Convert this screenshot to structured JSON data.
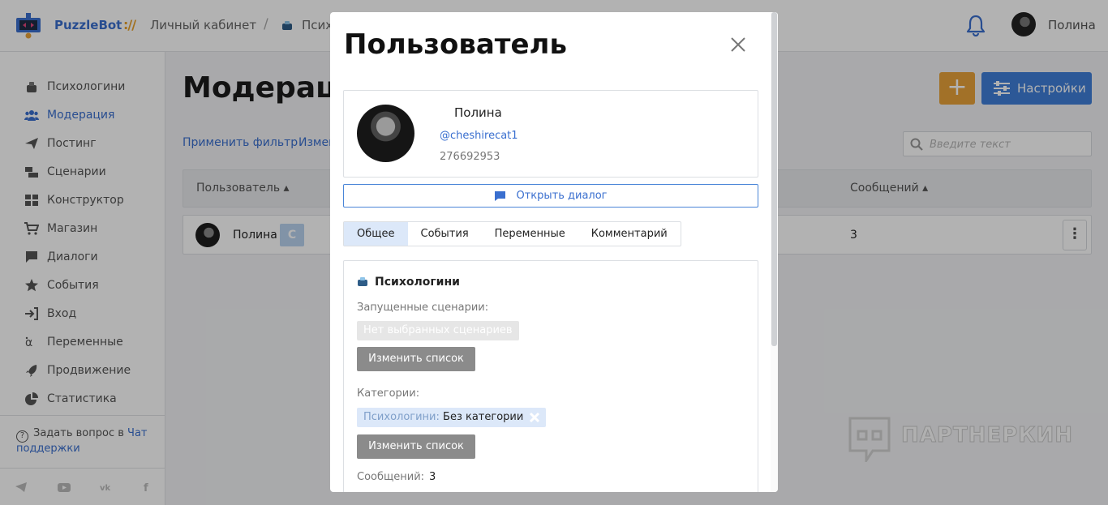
{
  "header": {
    "brand": "PuzzleBot",
    "separator": "://",
    "breadcrumb_root": "Личный кабинет",
    "breadcrumb_sep": "/",
    "breadcrumb_current": "Псих",
    "user_name": "Полина"
  },
  "sidebar": {
    "items": [
      {
        "label": "Психологини",
        "icon": "bot-icon"
      },
      {
        "label": "Модерация",
        "icon": "users-icon",
        "active": true
      },
      {
        "label": "Постинг",
        "icon": "send-icon"
      },
      {
        "label": "Сценарии",
        "icon": "scenarios-icon"
      },
      {
        "label": "Конструктор",
        "icon": "grid-icon"
      },
      {
        "label": "Магазин",
        "icon": "cart-icon"
      },
      {
        "label": "Диалоги",
        "icon": "chat-icon"
      },
      {
        "label": "События",
        "icon": "star-icon"
      },
      {
        "label": "Вход",
        "icon": "login-icon"
      },
      {
        "label": "Переменные",
        "icon": "alpha-icon"
      },
      {
        "label": "Продвижение",
        "icon": "rocket-icon"
      },
      {
        "label": "Статистика",
        "icon": "pie-icon"
      }
    ],
    "help_text": "Задать вопрос в",
    "help_link": "Чат поддержки",
    "social": [
      "telegram-icon",
      "youtube-icon",
      "vk-icon",
      "facebook-icon"
    ]
  },
  "main": {
    "title": "Модерац",
    "apply_filter": "Применить фильтр",
    "change_filter": "Измен",
    "add_label": "+",
    "settings_label": "Настройки",
    "search_placeholder": "Введите текст",
    "columns": {
      "user": "Пользователь ▴",
      "messages": "Сообщений ▴"
    },
    "rows": [
      {
        "name": "Полина",
        "badge": "С",
        "messages": "3"
      }
    ],
    "row_menu": "⋮"
  },
  "watermark": "ПАРТНЕРКИН",
  "modal": {
    "title": "Пользователь",
    "name": "Полина",
    "username": "@cheshirecat1",
    "user_id": "276692953",
    "open_dialog": "Открыть диалог",
    "tabs": [
      "Общее",
      "События",
      "Переменные",
      "Комментарий"
    ],
    "active_tab": 0,
    "section_title": "Психологини",
    "scenarios_label": "Запущенные сценарии:",
    "scenarios_empty": "Нет выбранных сценариев",
    "change_list": "Изменить список",
    "categories_label": "Категории:",
    "category_key": "Психологини:",
    "category_value": "Без категории",
    "messages_label": "Сообщений:",
    "messages_value": "3"
  },
  "colors": {
    "accent": "#3a6fcf",
    "add_button": "#e8a23a",
    "settings_button": "#3f7fd8"
  }
}
